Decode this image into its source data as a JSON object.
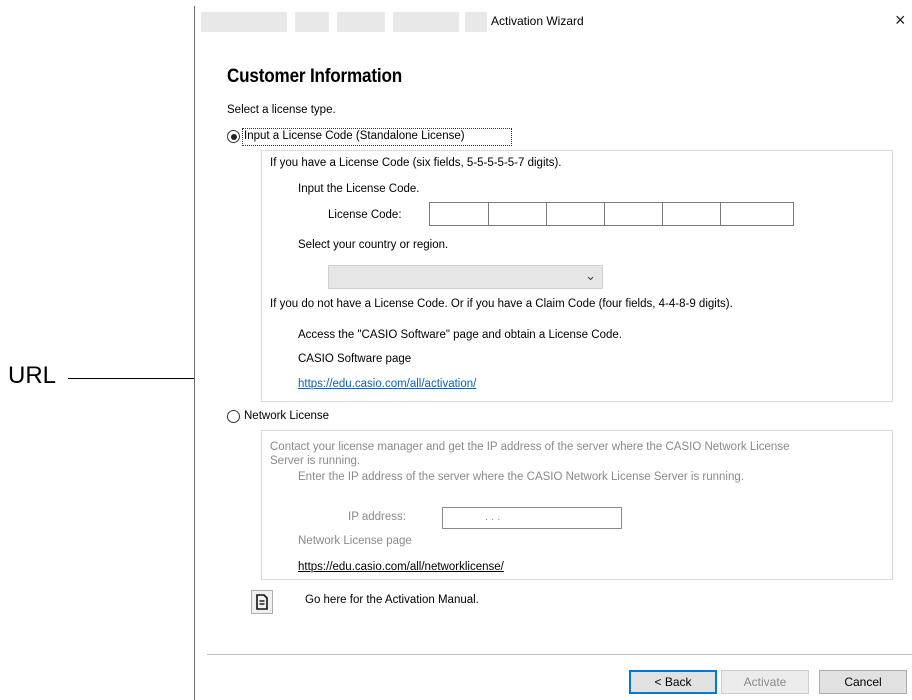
{
  "callout": {
    "label": "URL"
  },
  "window": {
    "title": "Activation Wizard",
    "close_glyph": "×"
  },
  "heading": "Customer Information",
  "select_prompt": "Select a license type.",
  "standalone": {
    "radio_label": "Input a License Code (Standalone License)",
    "selected": true,
    "has_code_text": "If you have a License Code (six fields, 5-5-5-5-5-7 digits).",
    "input_prompt": "Input the License Code.",
    "code_label": "License Code:",
    "code_fields": [
      "",
      "",
      "",
      "",
      "",
      ""
    ],
    "country_prompt": "Select your country or region.",
    "country_value": "",
    "no_code_text": "If you do not have a License Code. Or if you have a Claim Code (four fields, 4-4-8-9 digits).",
    "access_text": "Access the \"CASIO Software\" page and obtain a License Code.",
    "page_label": "CASIO Software page",
    "url": "https://edu.casio.com/all/activation/"
  },
  "network": {
    "radio_label": "Network License",
    "selected": false,
    "contact_text_1": "Contact your license manager and get the IP address of the server where the CASIO Network License",
    "contact_text_2": "Server is running.",
    "enter_text": "Enter the IP address of the server where the CASIO Network License Server is running.",
    "ip_label": "IP address:",
    "ip_value": ".          .          .",
    "page_label": "Network License page",
    "url": "https://edu.casio.com/all/networklicense/"
  },
  "manual": {
    "text": "Go here for the Activation Manual.",
    "icon": "document-icon"
  },
  "buttons": {
    "back": "< Back",
    "activate": "Activate",
    "cancel": "Cancel"
  }
}
